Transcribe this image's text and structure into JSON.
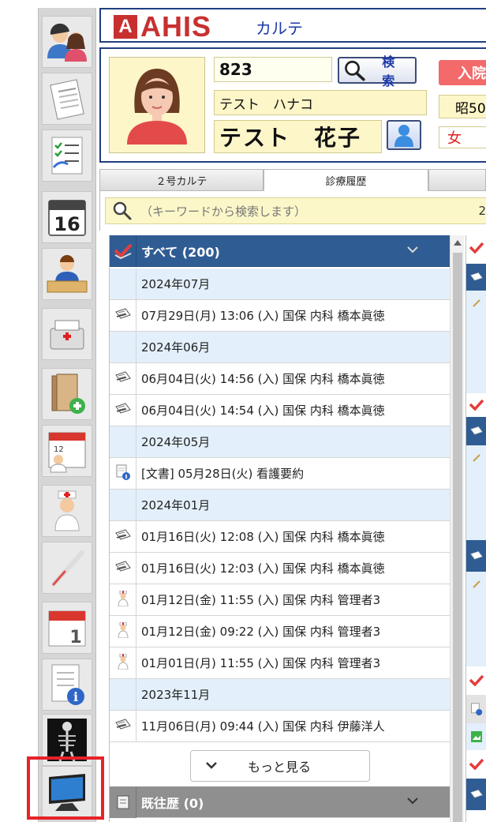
{
  "header": {
    "logo_letter": "A",
    "logo_text": "AHIS",
    "app_name": "カルテ"
  },
  "patient": {
    "id": "823",
    "search_label": "検 索",
    "kana": "テスト　ハナコ",
    "name": "テスト　花子",
    "status": "入院",
    "birth": "昭50",
    "sex": "女"
  },
  "tabs": [
    {
      "label": "２号カルテ"
    },
    {
      "label": "診療履歴"
    },
    {
      "label": ""
    }
  ],
  "keyword": {
    "placeholder": "（キーワードから検索します）",
    "right_text": "2"
  },
  "history": {
    "all_label": "すべて (200)",
    "rows": [
      {
        "type": "month",
        "text": "2024年07月"
      },
      {
        "type": "entry",
        "icon": "rx-pad-icon",
        "text": "07月29日(月) 13:06 (入) 国保 内科 橋本眞徳"
      },
      {
        "type": "month",
        "text": "2024年06月"
      },
      {
        "type": "entry",
        "icon": "rx-pad-icon",
        "text": "06月04日(火) 14:56 (入) 国保 内科 橋本眞徳"
      },
      {
        "type": "entry",
        "icon": "rx-pad-icon",
        "text": "06月04日(火) 14:54 (入) 国保 内科 橋本眞徳"
      },
      {
        "type": "month",
        "text": "2024年05月"
      },
      {
        "type": "entry",
        "icon": "document-info-icon",
        "text": "[文書] 05月28日(火) 看護要約"
      },
      {
        "type": "month",
        "text": "2024年01月"
      },
      {
        "type": "entry",
        "icon": "rx-pad-icon",
        "text": "01月16日(火) 12:08 (入) 国保 内科 橋本眞徳"
      },
      {
        "type": "entry",
        "icon": "rx-pad-icon",
        "text": "01月16日(火) 12:03 (入) 国保 内科 橋本眞徳"
      },
      {
        "type": "entry",
        "icon": "nurse-icon",
        "text": "01月12日(金) 11:55 (入) 国保 内科 管理者3"
      },
      {
        "type": "entry",
        "icon": "nurse-icon",
        "text": "01月12日(金) 09:22 (入) 国保 内科 管理者3"
      },
      {
        "type": "entry",
        "icon": "nurse-icon",
        "text": "01月01日(月) 11:55 (入) 国保 内科 管理者3"
      },
      {
        "type": "month",
        "text": "2023年11月"
      },
      {
        "type": "entry",
        "icon": "rx-pad-icon",
        "text": "11月06日(月) 09:44 (入) 国保 内科 伊藤洋人"
      }
    ],
    "more_label": "もっと見る",
    "past_label": "既往歴 (0)"
  },
  "toolbar": {
    "items": [
      {
        "name": "patients"
      },
      {
        "name": "insurance-form"
      },
      {
        "name": "checklist"
      },
      {
        "name": "calendar-16"
      },
      {
        "name": "reception"
      },
      {
        "name": "register"
      },
      {
        "name": "folder-add"
      },
      {
        "name": "schedule-calendar"
      },
      {
        "name": "nurse"
      },
      {
        "name": "thermometer"
      },
      {
        "name": "calendar-1"
      },
      {
        "name": "info-document"
      },
      {
        "name": "xray"
      },
      {
        "name": "monitor"
      }
    ],
    "selected_index": 13
  },
  "colors": {
    "brand": "#c83030",
    "navy": "#203e80",
    "list_header": "#2f5d93",
    "month_row": "#e3f0fb",
    "highlight": "#e6222a"
  }
}
